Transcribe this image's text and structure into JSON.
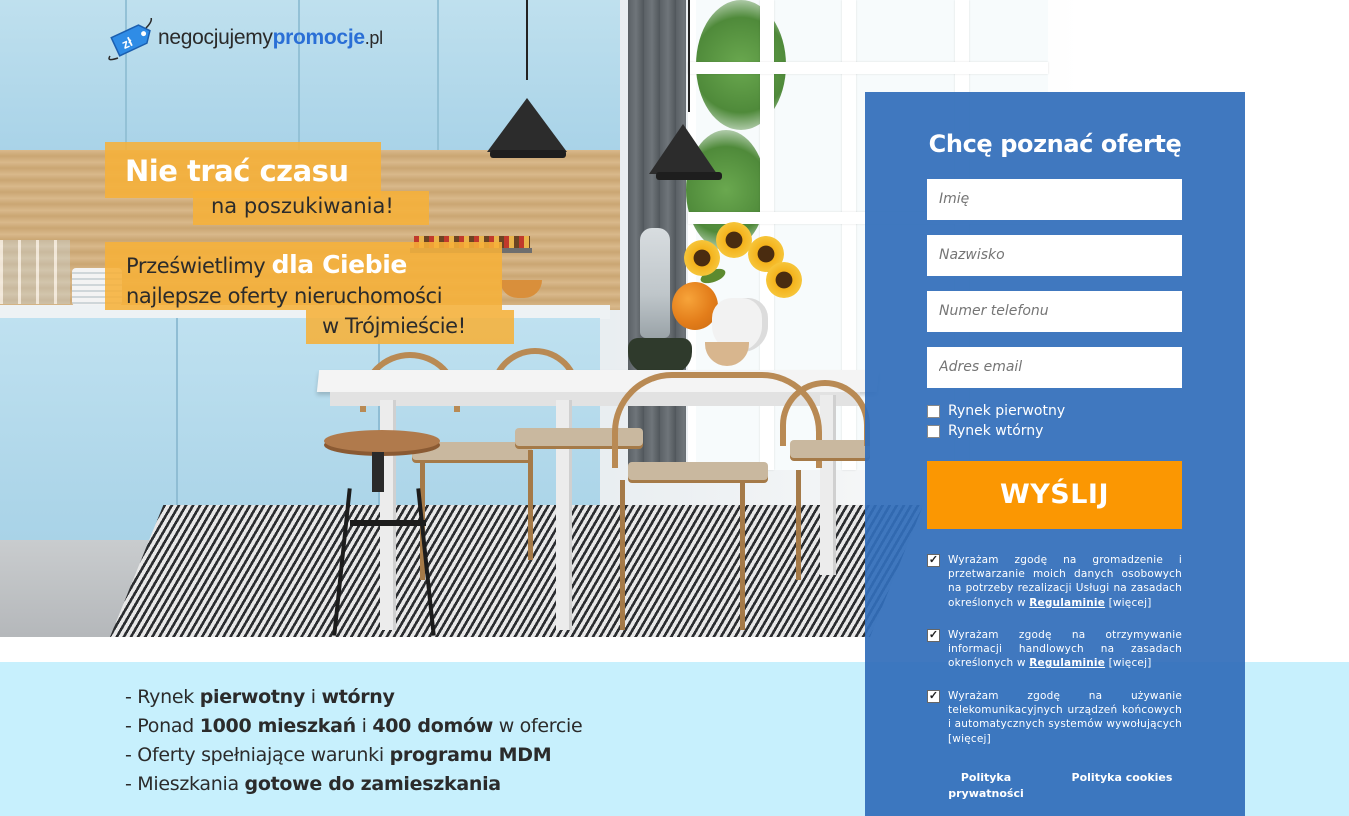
{
  "logo": {
    "part_dark": "negocjujemy",
    "part_blue": "promocje",
    "part_tld": ".pl",
    "tag_symbol": "zł",
    "brand_color": "#2a6fd6"
  },
  "hero": {
    "headline": "Nie trać czasu",
    "headline_sub": "na poszukiwania!",
    "lead_prefix": "Prześwietlimy",
    "lead_strong": "dla Ciebie",
    "lead_line2": "najlepsze oferty nieruchomości",
    "lead_line3": "w Trójmieście!",
    "banner_color": "#f6b039"
  },
  "features": [
    {
      "prefix": "- Rynek ",
      "strong1": "pierwotny",
      "mid": " i ",
      "strong2": "wtórny",
      "suffix": ""
    },
    {
      "prefix": "- Ponad ",
      "strong1": "1000 mieszkań",
      "mid": " i ",
      "strong2": "400 domów",
      "suffix": " w ofercie"
    },
    {
      "prefix": "- Oferty spełniające warunki ",
      "strong1": "programu MDM",
      "mid": "",
      "strong2": "",
      "suffix": ""
    },
    {
      "prefix": "- Mieszkania ",
      "strong1": "gotowe do zamieszkania",
      "mid": "",
      "strong2": "",
      "suffix": ""
    }
  ],
  "form": {
    "title": "Chcę poznać ofertę",
    "fields": {
      "first_name_placeholder": "Imię",
      "last_name_placeholder": "Nazwisko",
      "phone_placeholder": "Numer telefonu",
      "email_placeholder": "Adres email"
    },
    "market_primary": "Rynek pierwotny",
    "market_secondary": "Rynek wtórny",
    "submit_label": "WYŚLIJ",
    "consents": [
      {
        "text_before": "Wyrażam zgodę na gromadzenie i przetwarzanie moich danych osobowych na potrzeby rezalizacji Usługi na zasadach określonych w ",
        "link": "Regulaminie",
        "more": " [więcej]",
        "checked": true
      },
      {
        "text_before": "Wyrażam zgodę na otrzymywanie informacji handlowych na zasadach określonych w ",
        "link": "Regulaminie",
        "more": " [więcej]",
        "checked": true
      },
      {
        "text_before": "Wyrażam zgodę na używanie telekomunikacyjnych urządzeń końcowych i automatycznych systemów wywołujących",
        "link": "",
        "more": " [więcej]",
        "checked": true
      }
    ],
    "footer_links": {
      "privacy": "Polityka prywatności",
      "cookies": "Polityka cookies"
    },
    "panel_color": "#316eba",
    "button_color": "#fb9702"
  },
  "strip_color": "#c7f0fd"
}
